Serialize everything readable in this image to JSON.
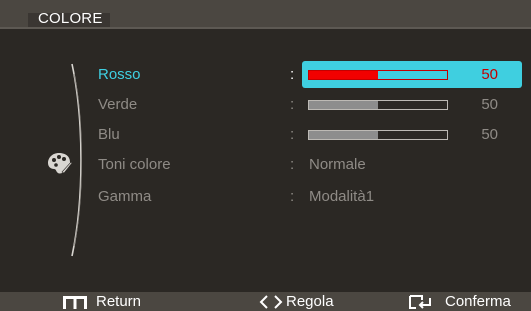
{
  "header": {
    "title": "COLORE"
  },
  "menu": {
    "items": [
      {
        "label": "Rosso",
        "type": "slider",
        "value": 50,
        "value_text": "50",
        "selected": true
      },
      {
        "label": "Verde",
        "type": "slider",
        "value": 50,
        "value_text": "50",
        "selected": false
      },
      {
        "label": "Blu",
        "type": "slider",
        "value": 50,
        "value_text": "50",
        "selected": false
      },
      {
        "label": "Toni colore",
        "type": "text",
        "value_text": "Normale",
        "selected": false
      },
      {
        "label": "Gamma",
        "type": "text",
        "value_text": "Modalità1",
        "selected": false
      }
    ],
    "separator": ":"
  },
  "footer": {
    "return_label": "Return",
    "adjust_label": "Regola",
    "confirm_label": "Conferma"
  },
  "colors": {
    "highlight": "#3fcfe0",
    "red_fill": "#f20000",
    "gray_fill": "#8d8d8d",
    "background": "#2b2824",
    "bar_background": "#4b4741"
  },
  "icons": [
    "palette-icon",
    "menu-icon",
    "left-right-arrows-icon",
    "enter-icon"
  ]
}
